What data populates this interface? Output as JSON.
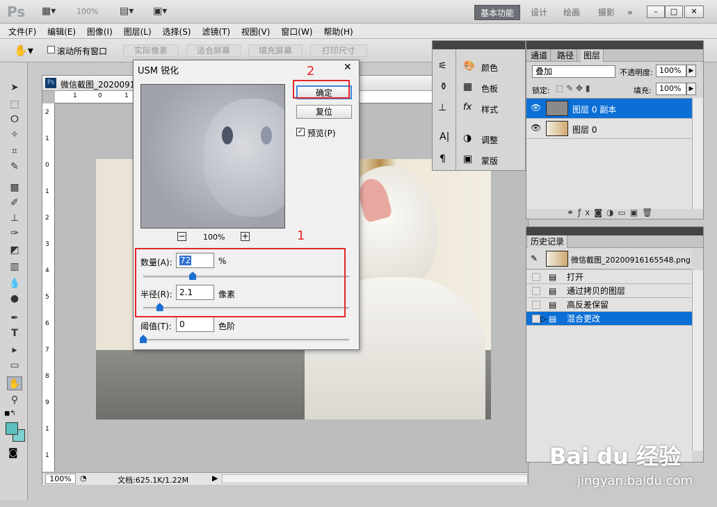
{
  "app": {
    "logo": "Ps",
    "zoom": "100%"
  },
  "workspaces": [
    "基本功能",
    "设计",
    "绘画",
    "摄影",
    "»"
  ],
  "window_buttons": [
    "–",
    "□",
    "✕"
  ],
  "menu": [
    "文件(F)",
    "编辑(E)",
    "图像(I)",
    "图层(L)",
    "选择(S)",
    "滤镜(T)",
    "视图(V)",
    "窗口(W)",
    "帮助(H)"
  ],
  "options": {
    "scroll_all": "滚动所有窗口",
    "actual_pixels": "实际像素",
    "fit_screen": "适合屏幕",
    "fill_screen": "填充屏幕",
    "print_size": "打印尺寸"
  },
  "document": {
    "title": "微信截图_2020091",
    "zoom": "100%",
    "doc_info": "文档:625.1K/1.22M",
    "h_ruler": [
      "1",
      "0",
      "1"
    ],
    "v_ruler": [
      "2",
      "1",
      "0",
      "1",
      "2",
      "3",
      "4",
      "5",
      "6",
      "7",
      "8",
      "9",
      "1",
      "1"
    ]
  },
  "dialog": {
    "title": "USM 锐化",
    "close": "✕",
    "ok": "确定",
    "reset": "复位",
    "preview_label": "预览(P)",
    "preview_checked": true,
    "zoom": "100%",
    "zoom_out": "−",
    "zoom_in": "+",
    "amount_label": "数量(A):",
    "amount_value": "72",
    "amount_unit": "%",
    "amount_slider": 0.24,
    "radius_label": "半径(R):",
    "radius_value": "2.1",
    "radius_unit": "像素",
    "radius_slider": 0.08,
    "threshold_label": "阈值(T):",
    "threshold_value": "0",
    "threshold_unit": "色阶",
    "threshold_slider": 0
  },
  "annotations": {
    "one": "1",
    "two": "2"
  },
  "mini_panel": {
    "items": [
      "颜色",
      "色板",
      "样式",
      "调整",
      "蒙版"
    ]
  },
  "layers_panel": {
    "tabs": [
      "通道",
      "路径",
      "图层"
    ],
    "blend_mode": "叠加",
    "opacity_label": "不透明度:",
    "opacity": "100%",
    "lock_label": "锁定:",
    "fill_label": "填充:",
    "fill": "100%",
    "layers": [
      {
        "name": "图层 0 副本",
        "selected": true
      },
      {
        "name": "图层 0",
        "selected": false
      }
    ]
  },
  "history_panel": {
    "tab": "历史记录",
    "snapshot": "微信截图_20200916165548.png",
    "items": [
      {
        "label": "打开",
        "selected": false
      },
      {
        "label": "通过拷贝的图层",
        "selected": false
      },
      {
        "label": "高反差保留",
        "selected": false
      },
      {
        "label": "混合更改",
        "selected": true
      }
    ]
  },
  "watermark": {
    "brand": "Bai du 经验",
    "url": "jingyan.baidu.com"
  },
  "colors": {
    "accent": "#0a6fd8",
    "annotation": "#e4262a",
    "fg_swatch": "#5cbfbf",
    "bg_swatch": "#7ecfcf"
  }
}
